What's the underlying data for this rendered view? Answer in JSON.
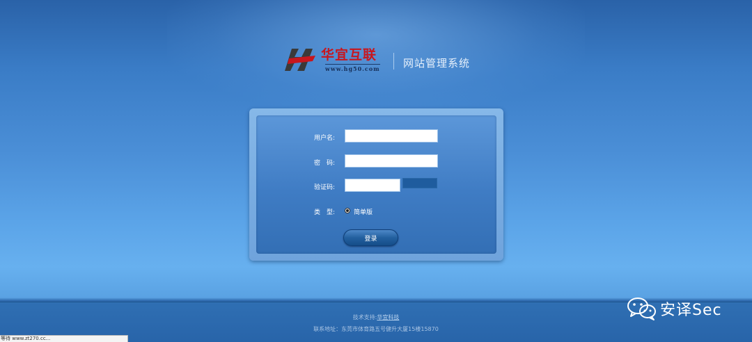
{
  "logo": {
    "company_name": "华宜互联",
    "url": "www.hg50.com",
    "system_title": "网站管理系统"
  },
  "login_form": {
    "username_label": "用户名:",
    "username_value": "",
    "password_label": "密　码:",
    "password_value": "",
    "captcha_label": "验证码:",
    "captcha_value": "",
    "type_label": "类　型:",
    "type_option": "简单版",
    "submit_label": "登录"
  },
  "footer": {
    "tech_support_label": "技术支持:",
    "tech_support_link": "华宜科技",
    "address_line": "联系地址：东莞市体育路五号健升大厦15楼15870"
  },
  "watermark": {
    "text": "安译Sec",
    "icon": "wechat-icon"
  },
  "status_bar": {
    "text": "等待 www.zt270.cc..."
  },
  "colors": {
    "background_top": "#2a62a8",
    "background_light": "#67b0ef",
    "panel_inner": "#3f7cc4",
    "logo_red": "#c8161d",
    "button": "#23609f"
  }
}
